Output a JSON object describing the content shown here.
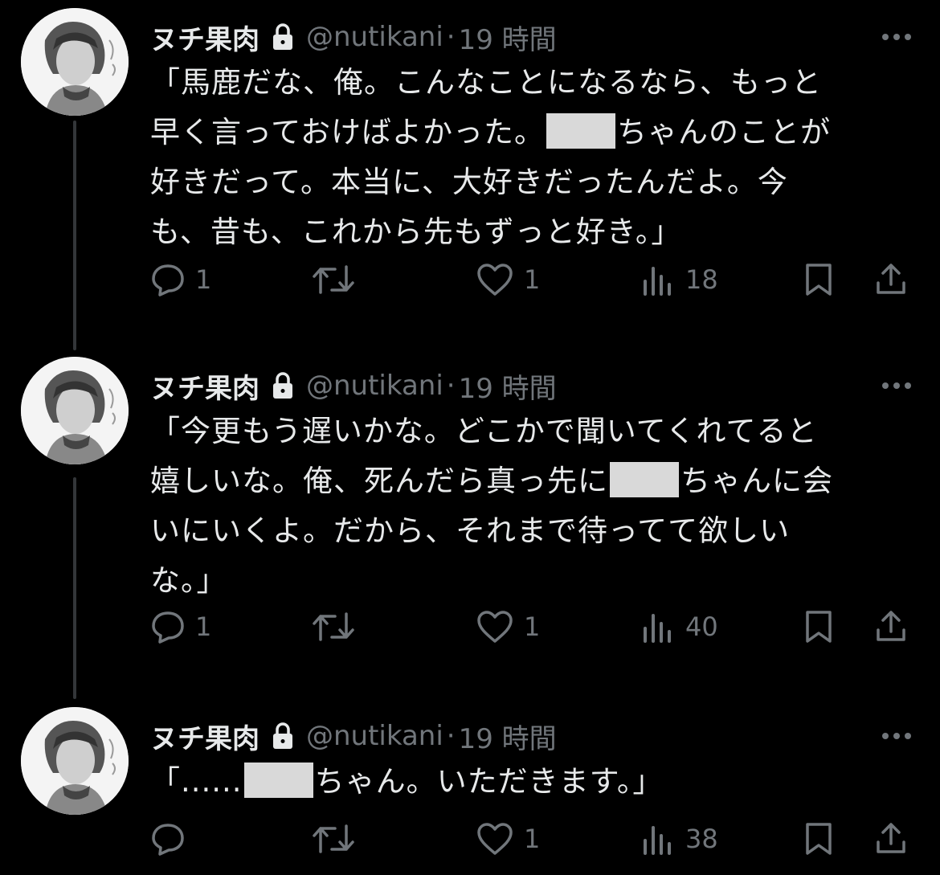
{
  "colors": {
    "background": "#000000",
    "text": "#e7e9ea",
    "muted": "#71767b",
    "thread_line": "#333639",
    "redaction": "#d9d9d9"
  },
  "tweets": [
    {
      "name": "ヌチ果肉",
      "handle": "@nutikani",
      "separator": "·",
      "time": "19 時間",
      "lines": [
        [
          "「馬鹿だな、俺。こんなことになるなら、もっと"
        ],
        [
          "早く言っておけばよかった。",
          "",
          "ちゃんのことが"
        ],
        [
          "好きだって。本当に、大好きだったんだよ。今"
        ],
        [
          "も、昔も、これから先もずっと好き。」"
        ]
      ],
      "replies": "1",
      "retweets": "",
      "likes": "1",
      "views": "18"
    },
    {
      "name": "ヌチ果肉",
      "handle": "@nutikani",
      "separator": "·",
      "time": "19 時間",
      "lines": [
        [
          "「今更もう遅いかな。どこかで聞いてくれてると"
        ],
        [
          "嬉しいな。俺、死んだら真っ先に",
          "",
          "ちゃんに会"
        ],
        [
          "いにいくよ。だから、それまで待ってて欲しい"
        ],
        [
          "な。」"
        ]
      ],
      "replies": "1",
      "retweets": "",
      "likes": "1",
      "views": "40"
    },
    {
      "name": "ヌチ果肉",
      "handle": "@nutikani",
      "separator": "·",
      "time": "19 時間",
      "lines": [
        [
          "「......",
          "",
          "ちゃん。いただきます。」"
        ]
      ],
      "replies": "",
      "retweets": "",
      "likes": "1",
      "views": "38"
    }
  ],
  "icons": {
    "lock": "lock-icon",
    "more": "more-options-icon",
    "reply": "reply-icon",
    "retweet": "retweet-icon",
    "like": "like-icon",
    "views": "views-icon",
    "bookmark": "bookmark-icon",
    "share": "share-icon",
    "avatar": "avatar-image"
  }
}
